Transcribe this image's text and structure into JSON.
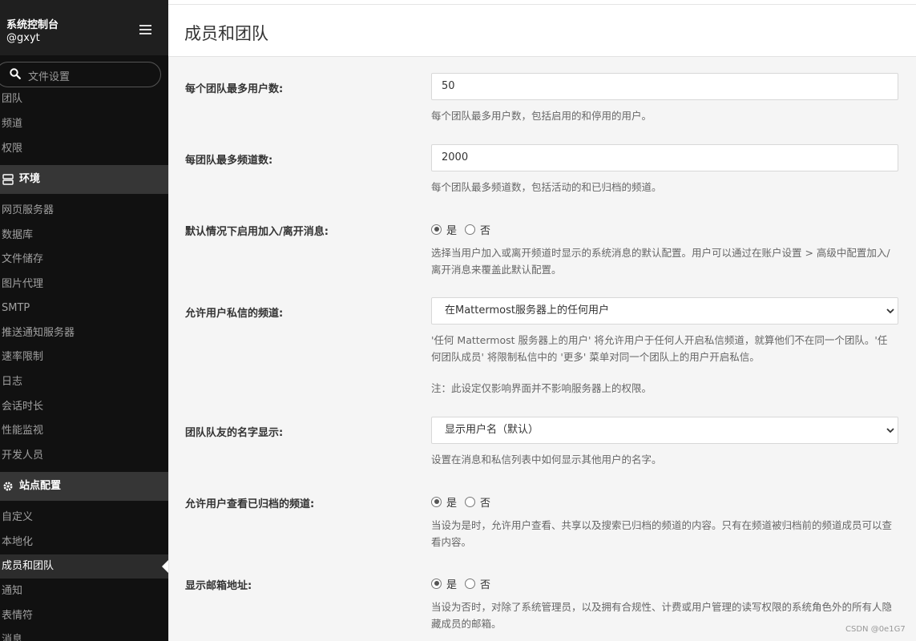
{
  "sidebar": {
    "title": "系统控制台",
    "user": "@gxyt",
    "search_placeholder": "文件设置",
    "items_top": [
      {
        "label": "团队"
      },
      {
        "label": "频道"
      },
      {
        "label": "权限"
      }
    ],
    "section_environment": "环境",
    "items_environment": [
      {
        "label": "网页服务器"
      },
      {
        "label": "数据库"
      },
      {
        "label": "文件储存"
      },
      {
        "label": "图片代理"
      },
      {
        "label": "SMTP"
      },
      {
        "label": "推送通知服务器"
      },
      {
        "label": "速率限制"
      },
      {
        "label": "日志"
      },
      {
        "label": "会话时长"
      },
      {
        "label": "性能监视"
      },
      {
        "label": "开发人员"
      }
    ],
    "section_site": "站点配置",
    "items_site": [
      {
        "label": "自定义"
      },
      {
        "label": "本地化"
      },
      {
        "label": "成员和团队",
        "active": true
      },
      {
        "label": "通知"
      },
      {
        "label": "表情符"
      },
      {
        "label": "消息"
      }
    ]
  },
  "page": {
    "title": "成员和团队"
  },
  "settings": {
    "max_users": {
      "label": "每个团队最多用户数:",
      "value": "50",
      "help": "每个团队最多用户数，包括启用的和停用的用户。"
    },
    "max_channels": {
      "label": "每团队最多频道数:",
      "value": "2000",
      "help": "每个团队最多频道数，包括活动的和已归档的频道。"
    },
    "join_leave": {
      "label": "默认情况下启用加入/离开消息:",
      "yes": "是",
      "no": "否",
      "selected": "yes",
      "help": "选择当用户加入或离开频道时显示的系统消息的默认配置。用户可以通过在账户设置 > 高级中配置加入/离开消息来覆盖此默认配置。"
    },
    "dm_channels": {
      "label": "允许用户私信的频道:",
      "value": "在Mattermost服务器上的任何用户",
      "help1": "'任何 Mattermost 服务器上的用户' 将允许用户于任何人开启私信频道，就算他们不在同一个团队。'任何团队成员' 将限制私信中的 '更多' 菜单对同一个团队上的用户开启私信。",
      "help2": "注：此设定仅影响界面并不影响服务器上的权限。"
    },
    "teammate_name": {
      "label": "团队队友的名字显示:",
      "value": "显示用户名（默认）",
      "help": "设置在消息和私信列表中如何显示其他用户的名字。"
    },
    "archived_channels": {
      "label": "允许用户查看已归档的频道:",
      "yes": "是",
      "no": "否",
      "selected": "yes",
      "help": "当设为是时，允许用户查看、共享以及搜索已归档的频道的内容。只有在频道被归档前的频道成员可以查看内容。"
    },
    "show_email": {
      "label": "显示邮箱地址:",
      "yes": "是",
      "no": "否",
      "selected": "yes",
      "help": "当设为否时，对除了系统管理员，以及拥有合规性、计费或用户管理的读写权限的系统角色外的所有人隐藏成员的邮箱。"
    }
  },
  "watermark": "CSDN @0e1G7"
}
